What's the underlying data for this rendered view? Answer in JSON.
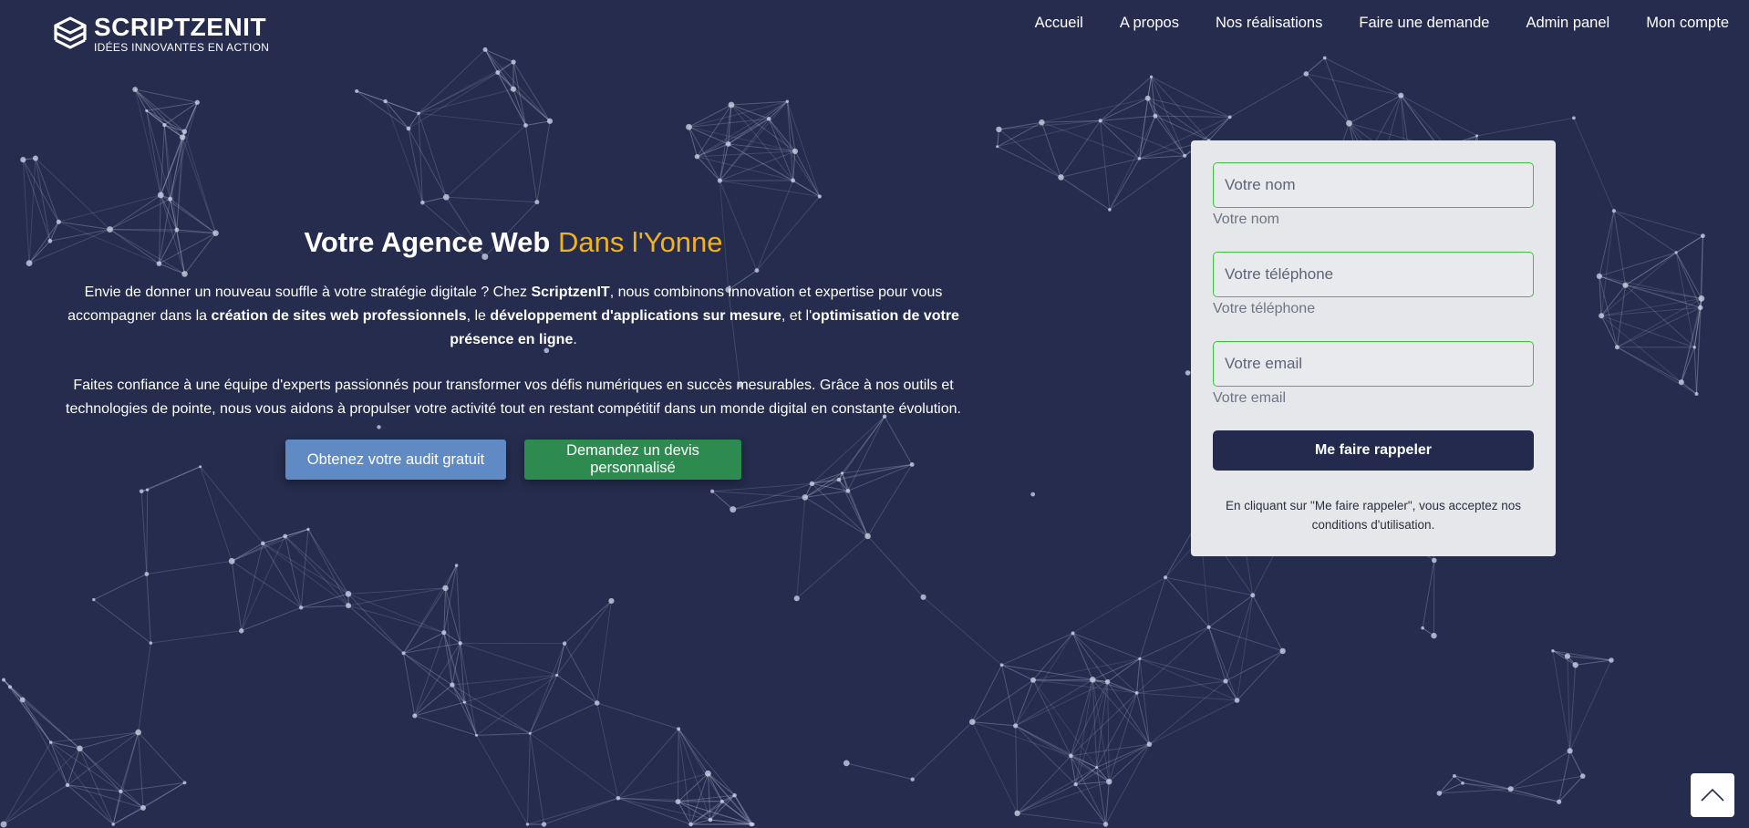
{
  "brand": {
    "name": "SCRIPTZENIT",
    "tagline": "IDÉES INNOVANTES EN ACTION",
    "logo_icon": "stacked-squares-logo-icon"
  },
  "nav": {
    "items": [
      {
        "label": "Accueil"
      },
      {
        "label": "A propos"
      },
      {
        "label": "Nos réalisations"
      },
      {
        "label": "Faire une demande"
      },
      {
        "label": "Admin panel"
      },
      {
        "label": "Mon compte"
      }
    ]
  },
  "hero": {
    "title_part1": "Votre Agence Web",
    "title_part2": "Dans l'Yonne",
    "p1": {
      "a": "Envie de donner un nouveau souffle à votre stratégie digitale ? Chez ",
      "b": "ScriptzenIT",
      "c": ", nous combinons innovation et expertise pour vous accompagner dans la ",
      "d": "création de sites web professionnels",
      "e": ", le ",
      "f": "développement d'applications sur mesure",
      "g": ", et l'",
      "h": "optimisation de votre présence en ligne",
      "i": "."
    },
    "p2": "Faites confiance à une équipe d'experts passionnés pour transformer vos défis numériques en succès mesurables. Grâce à nos outils et technologies de pointe, nous vous aidons à propulser votre activité tout en restant compétitif dans un monde digital en constante évolution.",
    "audit_button": "Obtenez votre audit gratuit",
    "devis_button": "Demandez un devis personnalisé"
  },
  "form": {
    "name_placeholder": "Votre nom",
    "name_label": "Votre nom",
    "phone_placeholder": "Votre téléphone",
    "phone_label": "Votre téléphone",
    "email_placeholder": "Votre email",
    "email_label": "Votre email",
    "submit_label": "Me faire rappeler",
    "consent_text": "En cliquant sur \"Me faire rappeler\", vous acceptez nos conditions d'utilisation."
  },
  "scroll_top": {
    "icon": "chevron-up-icon"
  },
  "colors": {
    "background": "#252c4d",
    "accent": "#f2b21c",
    "audit_button": "#5f8ac4",
    "devis_button": "#2e8b50",
    "field_border": "#40c040",
    "submit_button": "#232a4d"
  }
}
